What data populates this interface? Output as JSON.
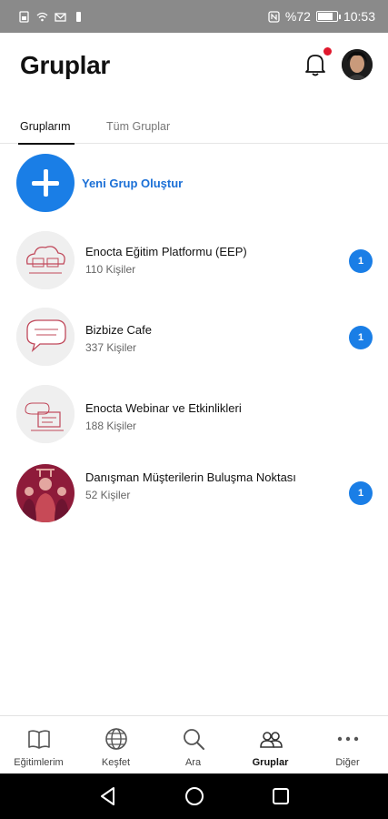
{
  "status_bar": {
    "battery": "%72",
    "battery_level": 0.72,
    "time": "10:53"
  },
  "header": {
    "title": "Gruplar",
    "notification_dot_color": "#e0182d"
  },
  "tabs": [
    {
      "label": "Gruplarım",
      "active": true
    },
    {
      "label": "Tüm Gruplar",
      "active": false
    }
  ],
  "new_group": {
    "label": "Yeni Grup Oluştur",
    "color": "#1a7ee6"
  },
  "groups": [
    {
      "name": "Enocta Eğitim Platformu (EEP)",
      "members": "110 Kişiler",
      "badge": "1"
    },
    {
      "name": "Bizbize Cafe",
      "members": "337 Kişiler",
      "badge": "1"
    },
    {
      "name": "Enocta Webinar ve Etkinlikleri",
      "members": "188 Kişiler",
      "badge": ""
    },
    {
      "name": "Danışman Müşterilerin Buluşma Noktası",
      "members": "52 Kişiler",
      "badge": "1"
    }
  ],
  "bottom_nav": [
    {
      "label": "Eğitimlerim",
      "icon": "book-icon"
    },
    {
      "label": "Keşfet",
      "icon": "globe-icon"
    },
    {
      "label": "Ara",
      "icon": "search-icon"
    },
    {
      "label": "Gruplar",
      "icon": "people-icon",
      "active": true
    },
    {
      "label": "Diğer",
      "icon": "more-icon"
    }
  ]
}
